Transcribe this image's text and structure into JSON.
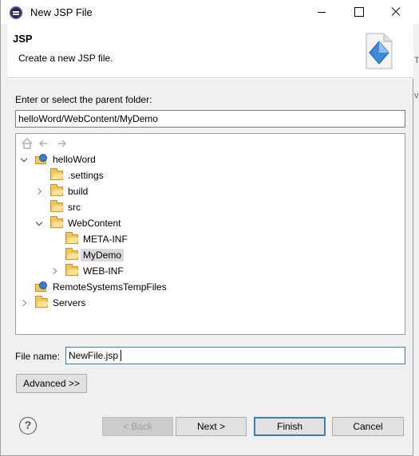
{
  "window": {
    "title": "New JSP File"
  },
  "banner": {
    "title": "JSP",
    "description": "Create a new JSP file."
  },
  "form": {
    "parent_label": "Enter or select the parent folder:",
    "parent_value": "helloWord/WebContent/MyDemo",
    "file_label": "File name:",
    "file_value": "NewFile.jsp"
  },
  "tree": {
    "toolbar": [
      "home-icon",
      "back-arrow-icon",
      "forward-arrow-icon"
    ],
    "nodes": [
      {
        "label": "helloWord",
        "type": "project",
        "state": "expanded",
        "depth": 0
      },
      {
        "label": ".settings",
        "type": "folder",
        "state": "leaf",
        "depth": 1
      },
      {
        "label": "build",
        "type": "folder",
        "state": "collapsed",
        "depth": 1
      },
      {
        "label": "src",
        "type": "folder",
        "state": "leaf",
        "depth": 1
      },
      {
        "label": "WebContent",
        "type": "folder",
        "state": "expanded",
        "depth": 1
      },
      {
        "label": "META-INF",
        "type": "folder",
        "state": "leaf",
        "depth": 2
      },
      {
        "label": "MyDemo",
        "type": "folder",
        "state": "leaf",
        "depth": 2,
        "selected": true
      },
      {
        "label": "WEB-INF",
        "type": "folder",
        "state": "collapsed",
        "depth": 2
      },
      {
        "label": "RemoteSystemsTempFiles",
        "type": "project",
        "state": "leaf",
        "depth": 0
      },
      {
        "label": "Servers",
        "type": "folder",
        "state": "collapsed",
        "depth": 0
      }
    ]
  },
  "buttons": {
    "advanced": "Advanced >>",
    "back": "< Back",
    "next": "Next >",
    "finish": "Finish",
    "cancel": "Cancel",
    "help": "?"
  },
  "background": {
    "right_text_1": "T",
    "right_text_2": "va"
  }
}
